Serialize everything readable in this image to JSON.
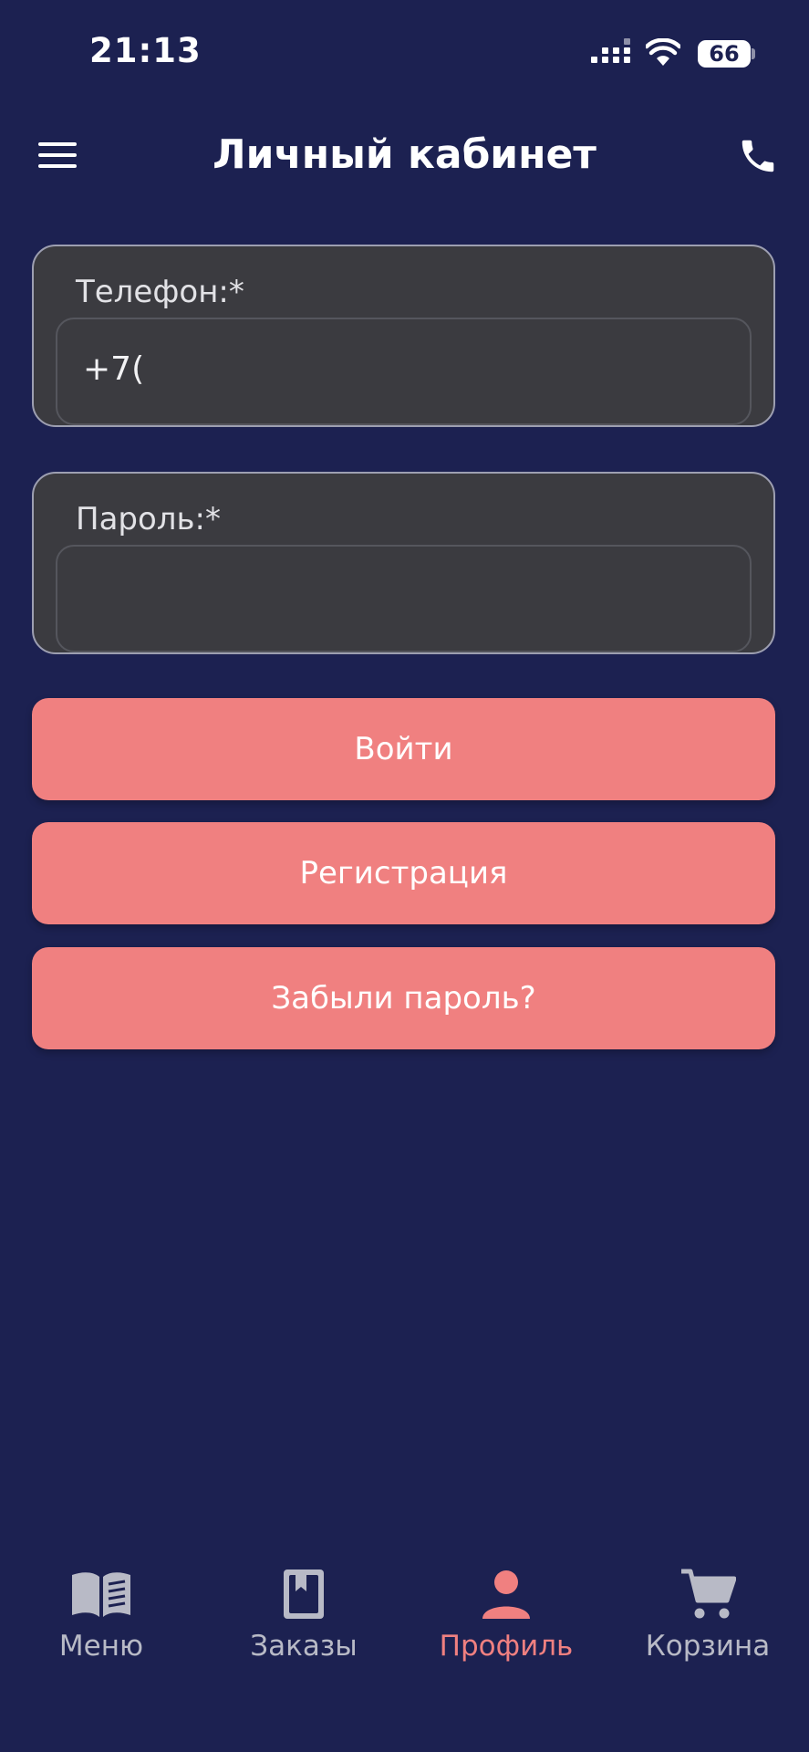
{
  "status_bar": {
    "time": "21:13",
    "battery": "66"
  },
  "header": {
    "title": "Личный кабинет"
  },
  "form": {
    "phone_label": "Телефон:*",
    "phone_value": "+7(",
    "password_label": "Пароль:*",
    "password_value": ""
  },
  "buttons": {
    "login": "Войти",
    "register": "Регистрация",
    "forgot": "Забыли пароль?"
  },
  "tabbar": [
    {
      "label": "Меню",
      "icon": "book-icon",
      "active": false
    },
    {
      "label": "Заказы",
      "icon": "bookmark-book-icon",
      "active": false
    },
    {
      "label": "Профиль",
      "icon": "person-icon",
      "active": true
    },
    {
      "label": "Корзина",
      "icon": "cart-icon",
      "active": false
    }
  ],
  "colors": {
    "background": "#1c2151",
    "field": "#3b3b40",
    "accent": "#f08080",
    "tab_inactive": "#b8bac6"
  }
}
